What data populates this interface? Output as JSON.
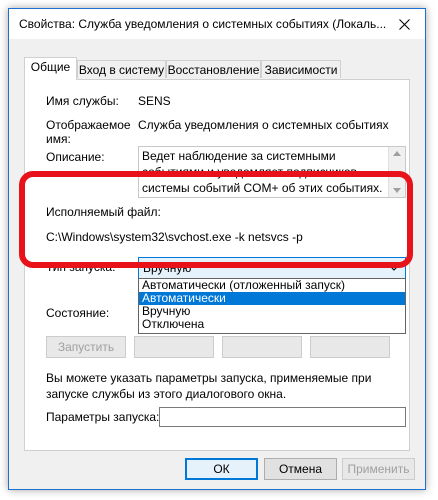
{
  "window": {
    "title": "Свойства: Служба уведомления о системных событиях (Локаль..."
  },
  "tabs": [
    {
      "label": "Общие"
    },
    {
      "label": "Вход в систему"
    },
    {
      "label": "Восстановление"
    },
    {
      "label": "Зависимости"
    }
  ],
  "general": {
    "service_name_label": "Имя службы:",
    "service_name_value": "SENS",
    "display_name_label_line1": "Отображаемое",
    "display_name_label_line2": "имя:",
    "display_name_value": "Служба уведомления о системных событиях",
    "description_label": "Описание:",
    "description_value": "Ведет наблюдение за системными событиями и уведомляет подписчиков системы событий COM+ об этих событиях.",
    "exe_label": "Исполняемый файл:",
    "exe_value": "C:\\Windows\\system32\\svchost.exe -k netsvcs -p",
    "startup_type_label": "Тип запуска:",
    "startup_type_value": "Вручную",
    "startup_options": [
      "Автоматически (отложенный запуск)",
      "Автоматически",
      "Вручную",
      "Отключена"
    ],
    "status_label": "Состояние:",
    "start_button": "Запустить",
    "hint_text": "Вы можете указать параметры запуска, применяемые при запуске службы из этого диалогового окна.",
    "start_params_label": "Параметры запуска:",
    "start_params_value": ""
  },
  "footer": {
    "ok": "ОК",
    "cancel": "Отмена",
    "apply": "Применить"
  },
  "colors": {
    "highlight": "#e8121b",
    "accent": "#0078d7"
  }
}
